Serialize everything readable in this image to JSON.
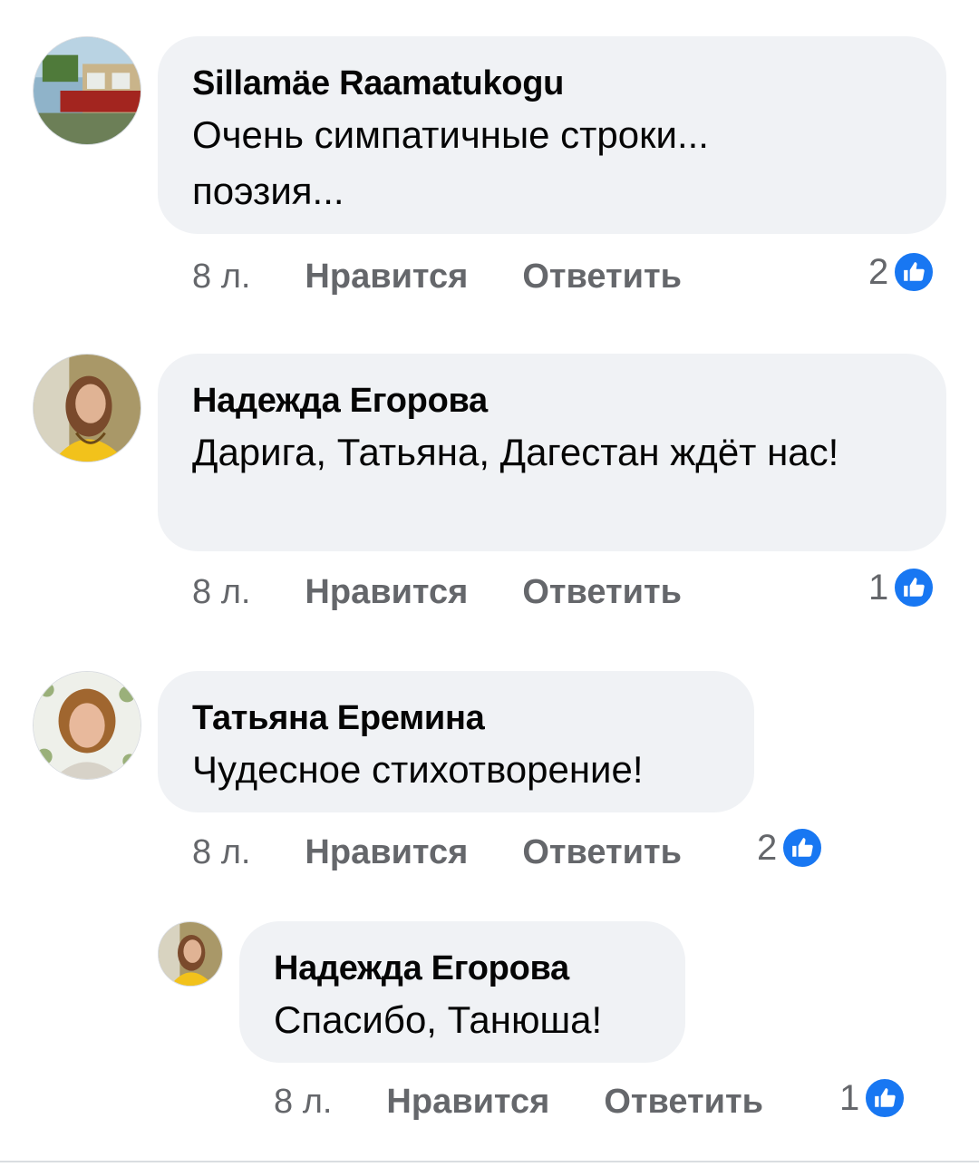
{
  "comments": [
    {
      "author": "Sillamäe Raamatukogu",
      "text": "Очень симпатичные строки... поэзия...",
      "time": "8 л.",
      "like_label": "Нравится",
      "reply_label": "Ответить",
      "likes": "2",
      "avatar": "library-storefront-photo"
    },
    {
      "author": "Надежда Егорова",
      "text": "Дарига, Татьяна, Дагестан ждёт нас!",
      "time": "8 л.",
      "like_label": "Нравится",
      "reply_label": "Ответить",
      "likes": "1",
      "avatar": "woman-yellow-dress-photo"
    },
    {
      "author": "Татьяна Еремина",
      "text": "Чудесное стихотворение!",
      "time": "8 л.",
      "like_label": "Нравится",
      "reply_label": "Ответить",
      "likes": "2",
      "avatar": "woman-floral-frame-photo"
    },
    {
      "author": "Надежда Егорова",
      "text": "Спасибо, Танюша!",
      "time": "8 л.",
      "like_label": "Нравится",
      "reply_label": "Ответить",
      "likes": "1",
      "avatar": "woman-yellow-dress-photo"
    }
  ],
  "colors": {
    "bubble": "#f0f2f5",
    "meta_text": "#65676b",
    "like_badge": "#1877f2"
  },
  "icons": {
    "like": "thumbs-up-icon"
  }
}
